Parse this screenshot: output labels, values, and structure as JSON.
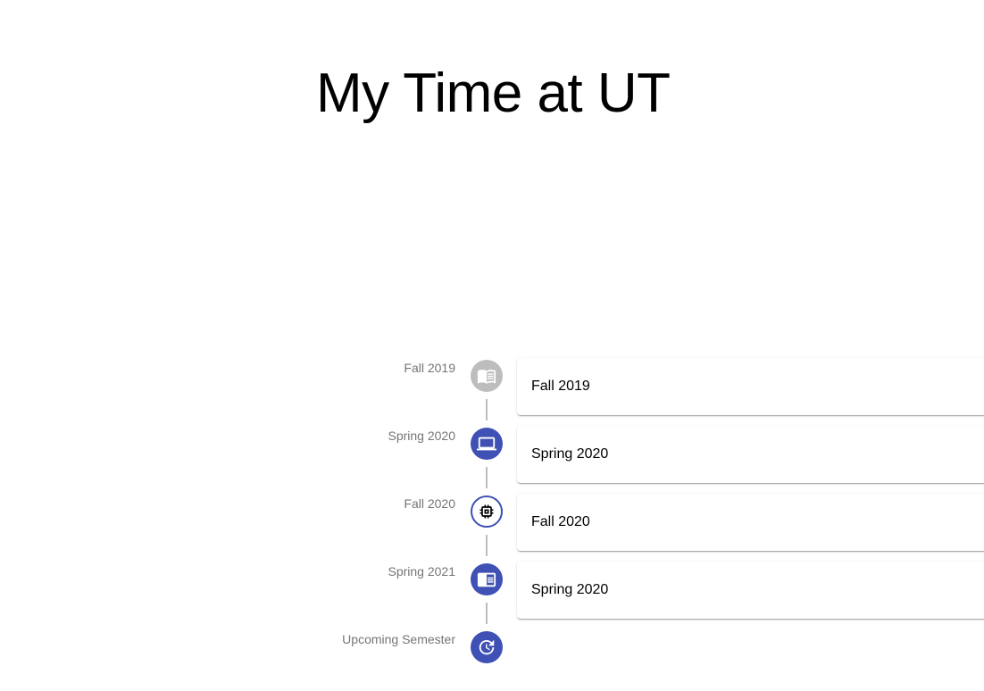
{
  "page": {
    "title": "My Time at UT"
  },
  "colors": {
    "primary": "#3f51b5",
    "grey_dot": "#bdbdbd",
    "connector": "#bdbdbd",
    "label_text": "#757575"
  },
  "timeline": {
    "items": [
      {
        "date_label": "Fall 2019",
        "card_label": "Fall 2019",
        "icon": "book-icon",
        "dot_style": "grey"
      },
      {
        "date_label": "Spring 2020",
        "card_label": "Spring 2020",
        "icon": "laptop-icon",
        "dot_style": "primary"
      },
      {
        "date_label": "Fall 2020",
        "card_label": "Fall 2020",
        "icon": "chip-icon",
        "dot_style": "outlined"
      },
      {
        "date_label": "Spring 2021",
        "card_label": "Spring 2020",
        "icon": "chrome-reader-icon",
        "dot_style": "primary"
      },
      {
        "date_label": "Upcoming Semester",
        "card_label": null,
        "icon": "update-icon",
        "dot_style": "primary"
      }
    ]
  }
}
